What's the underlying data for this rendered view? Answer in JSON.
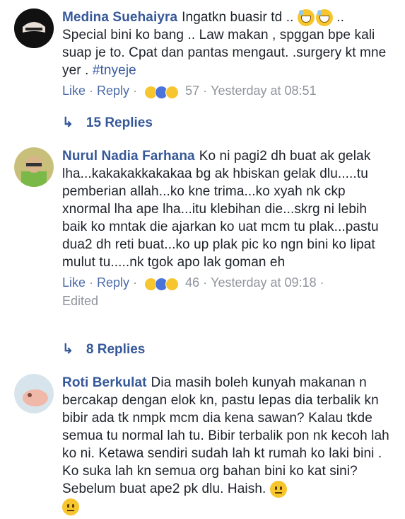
{
  "comments": [
    {
      "author": "Medina Suehaiyra",
      "text_parts": [
        "Ingatkn buasir td .. ",
        " .. Special bini ko bang .. Law makan , spggan bpe kali suap je to. Cpat dan pantas mengaut. .surgery kt mne yer . "
      ],
      "hashtag": "#tnyeje",
      "like": "Like",
      "reply": "Reply",
      "reaction_count": "57",
      "time": "Yesterday at 08:51",
      "replies_label": "15 Replies"
    },
    {
      "author": "Nurul Nadia Farhana",
      "text": "Ko ni pagi2 dh buat ak gelak lha...kakakakkakakaa bg ak hbiskan gelak dlu.....tu pemberian allah...ko kne trima...ko xyah nk ckp xnormal lha ape lha...itu klebihan die...skrg ni lebih baik ko mntak die ajarkan ko uat mcm tu plak...pastu dua2 dh reti buat...ko up plak pic ko ngn bini ko lipat mulut tu.....nk tgok apo lak goman eh",
      "like": "Like",
      "reply": "Reply",
      "reaction_count": "46",
      "time": "Yesterday at 09:18",
      "edited": "Edited",
      "replies_label": "8 Replies"
    },
    {
      "author": "Roti Berkulat",
      "text": "Dia masih boleh kunyah makanan n bercakap dengan elok kn, pastu lepas dia terbalik kn bibir ada tk nmpk mcm dia kena sawan? Kalau tkde semua tu normal lah tu. Bibir terbalik pon nk kecoh lah ko ni. Ketawa sendiri sudah lah kt rumah ko laki bini . Ko suka lah kn semua org bahan bini ko kat sini? Sebelum buat ape2 pk dlu. Haish. "
    }
  ],
  "colors": {
    "link": "#365899",
    "meta": "#90949c",
    "text": "#1d2129"
  }
}
